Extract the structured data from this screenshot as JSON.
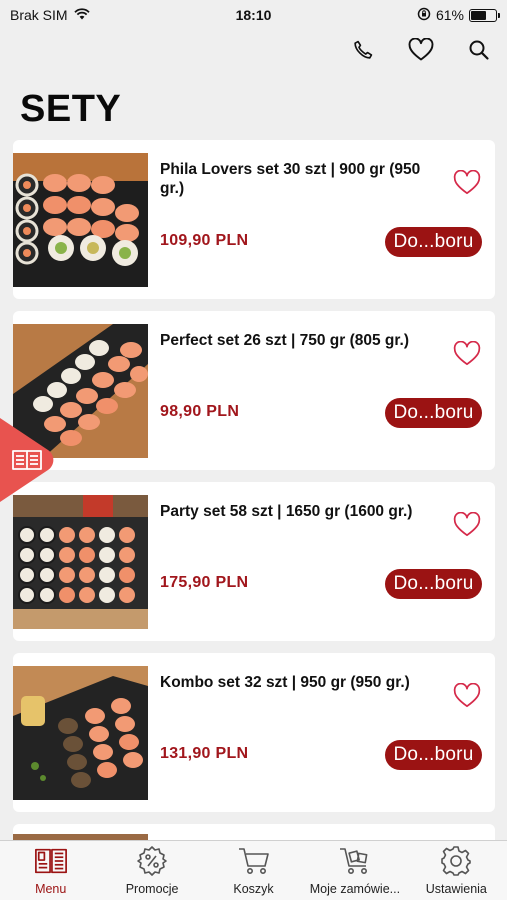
{
  "status_bar": {
    "carrier": "Brak SIM",
    "time": "18:10",
    "battery_percent": "61%",
    "battery_level": 0.61
  },
  "header": {
    "title": "SETY",
    "icons": [
      "phone-icon",
      "heart-icon",
      "search-icon"
    ]
  },
  "colors": {
    "accent": "#9b1313",
    "price": "#a1161c",
    "side_tab": "#e8534f"
  },
  "products": [
    {
      "name": "Phila Lovers set 30 szt | 900 gr (950 gr.)",
      "price": "109,90 PLN",
      "button_label": "Do...boru"
    },
    {
      "name": "Perfect set 26 szt | 750 gr (805 gr.)",
      "price": "98,90 PLN",
      "button_label": "Do...boru"
    },
    {
      "name": "Party set 58 szt | 1650 gr (1600 gr.)",
      "price": "175,90 PLN",
      "button_label": "Do...boru"
    },
    {
      "name": "Kombo set 32 szt | 950 gr (950 gr.)",
      "price": "131,90 PLN",
      "button_label": "Do...boru"
    }
  ],
  "tabbar": {
    "items": [
      {
        "label": "Menu",
        "icon": "menu-book-icon",
        "active": true
      },
      {
        "label": "Promocje",
        "icon": "promo-badge-icon",
        "active": false
      },
      {
        "label": "Koszyk",
        "icon": "cart-icon",
        "active": false
      },
      {
        "label": "Moje zamówie...",
        "icon": "orders-cart-icon",
        "active": false
      },
      {
        "label": "Ustawienia",
        "icon": "gear-icon",
        "active": false
      }
    ]
  }
}
